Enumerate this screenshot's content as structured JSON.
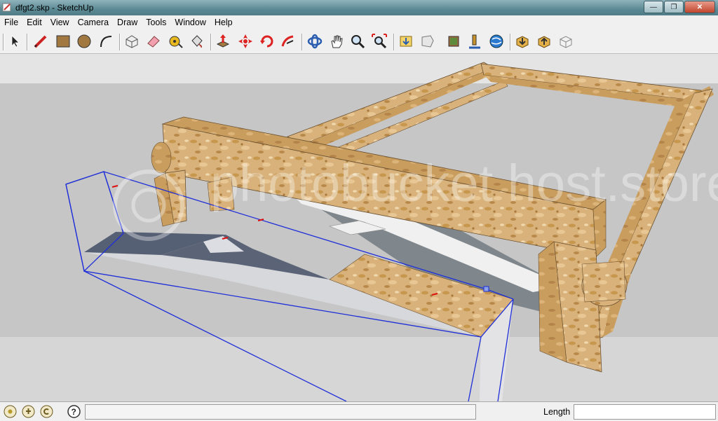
{
  "window": {
    "title": "dfgt2.skp - SketchUp"
  },
  "menu": [
    {
      "id": "file",
      "label": "File"
    },
    {
      "id": "edit",
      "label": "Edit"
    },
    {
      "id": "view",
      "label": "View"
    },
    {
      "id": "camera",
      "label": "Camera"
    },
    {
      "id": "draw",
      "label": "Draw"
    },
    {
      "id": "tools",
      "label": "Tools"
    },
    {
      "id": "window",
      "label": "Window"
    },
    {
      "id": "help",
      "label": "Help"
    }
  ],
  "toolbar": [
    "select-icon",
    "pencil-line-icon",
    "rectangle-icon",
    "circle-icon",
    "arc-icon",
    "make-component-icon",
    "eraser-icon",
    "tape-measure-icon",
    "paint-bucket-icon",
    "push-pull-icon",
    "move-icon",
    "rotate-icon",
    "follow-me-icon",
    "orbit-icon",
    "pan-icon",
    "zoom-icon",
    "zoom-extents-icon",
    "get-models-icon",
    "share-model-icon",
    "photo-textures-icon",
    "add-location-icon",
    "google-earth-icon",
    "get-models-3d-icon",
    "share-component-icon",
    "component-icon"
  ],
  "viewport": {
    "watermark": "photobucket host.store.share."
  },
  "statusbar": {
    "status_text": "",
    "measure_label": "Length",
    "measure_value": ""
  }
}
